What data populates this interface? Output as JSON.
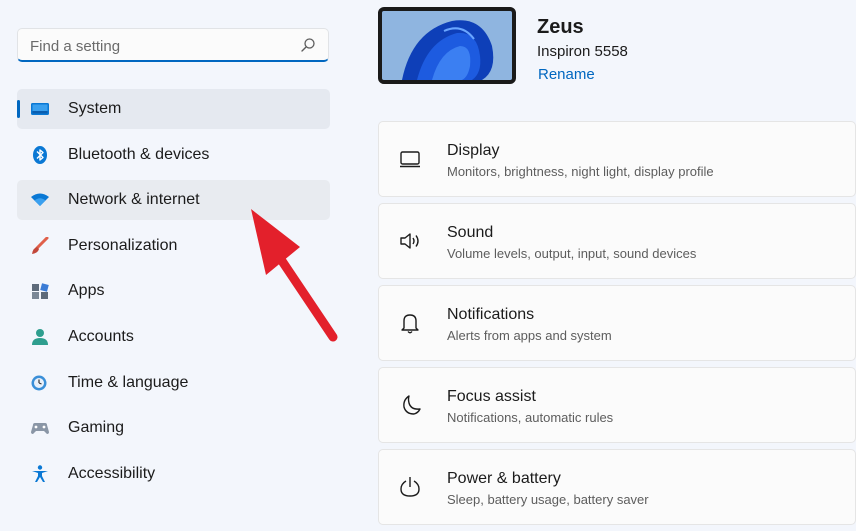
{
  "search": {
    "placeholder": "Find a setting",
    "value": ""
  },
  "sidebar": {
    "items": [
      {
        "label": "System",
        "icon": "system-icon",
        "active": true
      },
      {
        "label": "Bluetooth & devices",
        "icon": "bluetooth-icon"
      },
      {
        "label": "Network & internet",
        "icon": "wifi-icon",
        "hover": true
      },
      {
        "label": "Personalization",
        "icon": "brush-icon"
      },
      {
        "label": "Apps",
        "icon": "apps-icon"
      },
      {
        "label": "Accounts",
        "icon": "account-icon"
      },
      {
        "label": "Time & language",
        "icon": "clock-globe-icon"
      },
      {
        "label": "Gaming",
        "icon": "gamepad-icon"
      },
      {
        "label": "Accessibility",
        "icon": "accessibility-icon"
      }
    ]
  },
  "device": {
    "name": "Zeus",
    "model": "Inspiron 5558",
    "rename_label": "Rename"
  },
  "settings": [
    {
      "title": "Display",
      "subtitle": "Monitors, brightness, night light, display profile",
      "icon": "monitor-icon"
    },
    {
      "title": "Sound",
      "subtitle": "Volume levels, output, input, sound devices",
      "icon": "speaker-icon"
    },
    {
      "title": "Notifications",
      "subtitle": "Alerts from apps and system",
      "icon": "bell-icon"
    },
    {
      "title": "Focus assist",
      "subtitle": "Notifications, automatic rules",
      "icon": "moon-icon"
    },
    {
      "title": "Power & battery",
      "subtitle": "Sleep, battery usage, battery saver",
      "icon": "power-icon"
    }
  ],
  "colors": {
    "accent": "#0067c0",
    "annotation_arrow": "#e3202b"
  }
}
